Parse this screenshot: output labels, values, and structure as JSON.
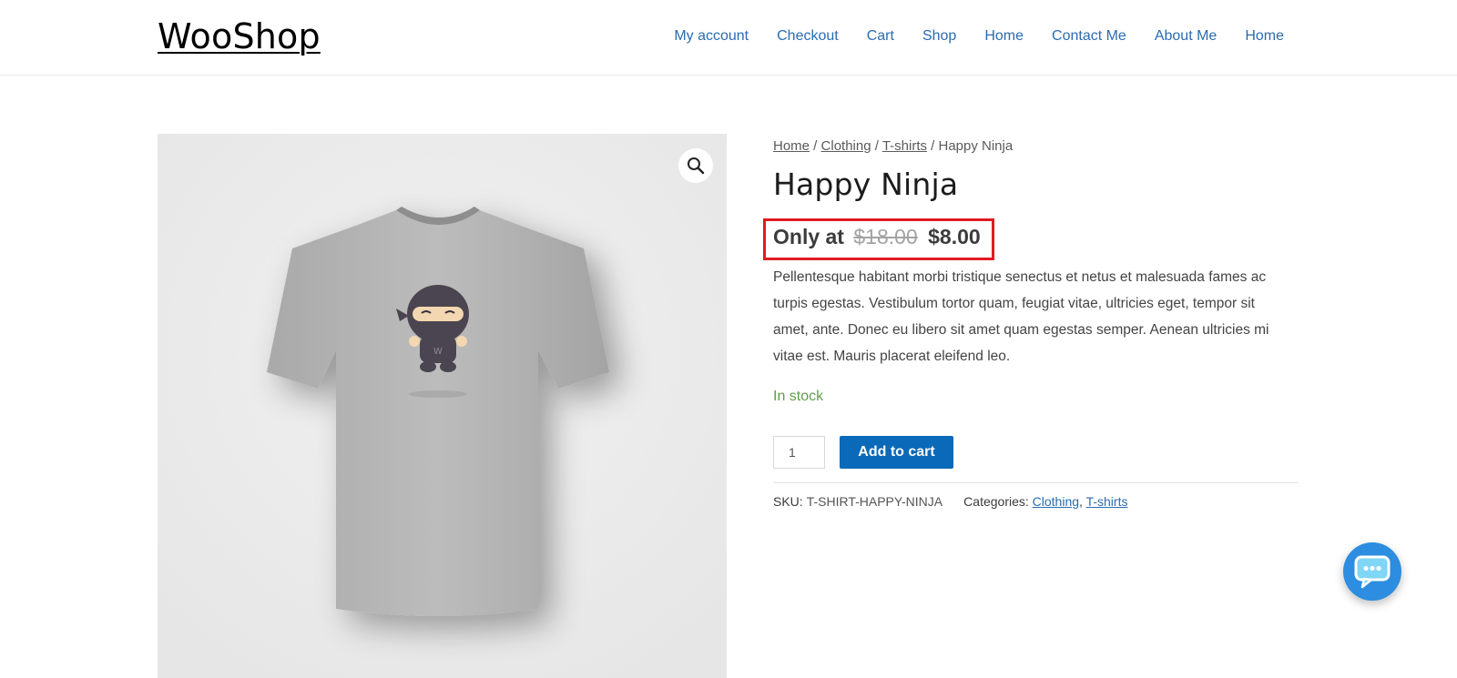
{
  "header": {
    "site_title": "WooShop",
    "nav": [
      "My account",
      "Checkout",
      "Cart",
      "Shop",
      "Home",
      "Contact Me",
      "About Me",
      "Home"
    ]
  },
  "breadcrumb": {
    "home": "Home",
    "sep1": " / ",
    "clothing": "Clothing",
    "sep2": " / ",
    "tshirts": "T-shirts",
    "current": " / Happy Ninja"
  },
  "product": {
    "title": "Happy Ninja",
    "price_prefix": "Only at",
    "old_price": "$18.00",
    "new_price": "$8.00",
    "description": "Pellentesque habitant morbi tristique senectus et netus et malesuada fames ac turpis egestas. Vestibulum tortor quam, feugiat vitae, ultricies eget, tempor sit amet, ante. Donec eu libero sit amet quam egestas semper. Aenean ultricies mi vitae est. Mauris placerat eleifend leo.",
    "stock": "In stock",
    "quantity": "1",
    "add_to_cart": "Add to cart",
    "sku_label": "SKU:",
    "sku": "T-SHIRT-HAPPY-NINJA",
    "categories_label": "Categories:",
    "category1": "Clothing",
    "category_sep": ", ",
    "category2": "T-shirts"
  },
  "colors": {
    "accent": "#0a69b8",
    "nav_link": "#2a6cb0",
    "highlight_box": "#e01b24",
    "stock": "#5f9f49",
    "chat": "#2d8de0"
  },
  "icons": {
    "zoom": "magnifier-icon",
    "chat": "chat-bubble-icon",
    "ninja": "ninja-mascot-icon"
  }
}
